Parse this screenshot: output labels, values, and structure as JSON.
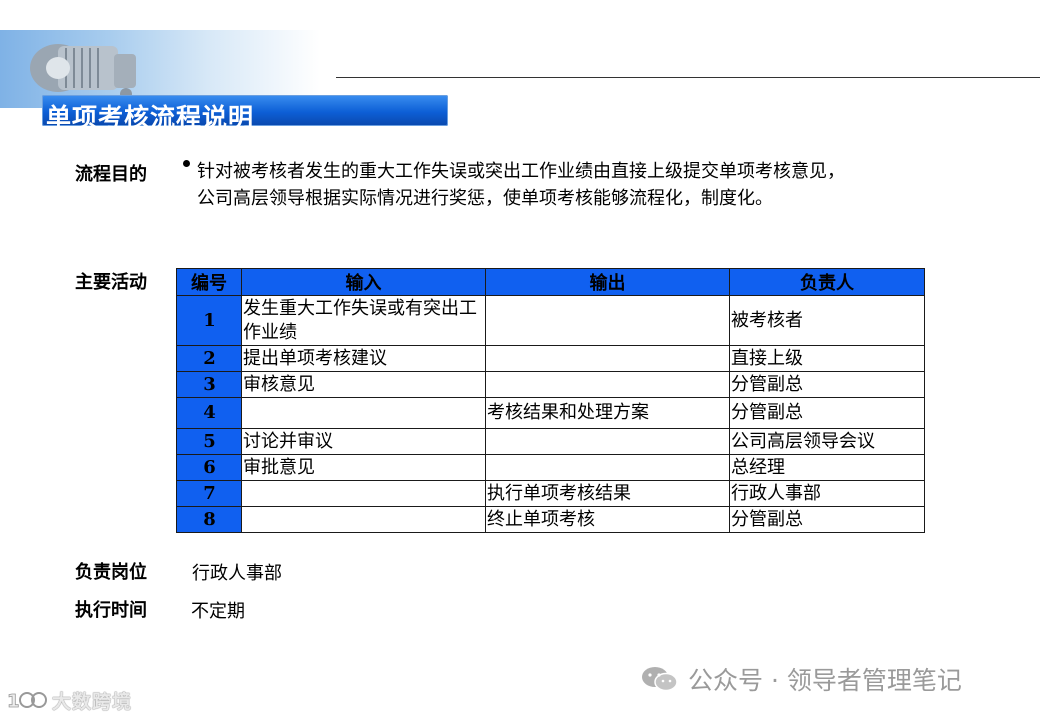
{
  "header": {
    "title": "单项考核流程说明"
  },
  "purpose": {
    "label": "流程目的",
    "line1": "针对被考核者发生的重大工作失误或突出工作业绩由直接上级提交单项考核意见，",
    "line2": "公司高层领导根据实际情况进行奖惩，使单项考核能够流程化，制度化。"
  },
  "activities": {
    "label": "主要活动",
    "columns": [
      "编号",
      "输入",
      "输出",
      "负责人"
    ],
    "rows": [
      {
        "no": "1",
        "input": "发生重大工作失误或有突出工作业绩",
        "output": "",
        "owner": "被考核者"
      },
      {
        "no": "2",
        "input": "提出单项考核建议",
        "output": "",
        "owner": "直接上级"
      },
      {
        "no": "3",
        "input": "审核意见",
        "output": "",
        "owner": "分管副总"
      },
      {
        "no": "4",
        "input": "",
        "output": "考核结果和处理方案",
        "owner": "分管副总"
      },
      {
        "no": "5",
        "input": "讨论并审议",
        "output": "",
        "owner": "公司高层领导会议"
      },
      {
        "no": "6",
        "input": "审批意见",
        "output": "",
        "owner": "总经理"
      },
      {
        "no": "7",
        "input": "",
        "output": "执行单项考核结果",
        "owner": "行政人事部"
      },
      {
        "no": "8",
        "input": "",
        "output": "终止单项考核",
        "owner": "分管副总"
      }
    ]
  },
  "responsible": {
    "label": "负责岗位",
    "value": "行政人事部"
  },
  "schedule": {
    "label": "执行时间",
    "value": "不定期"
  },
  "watermarks": {
    "right": "公众号 · 领导者管理笔记",
    "left": "大数跨境"
  }
}
